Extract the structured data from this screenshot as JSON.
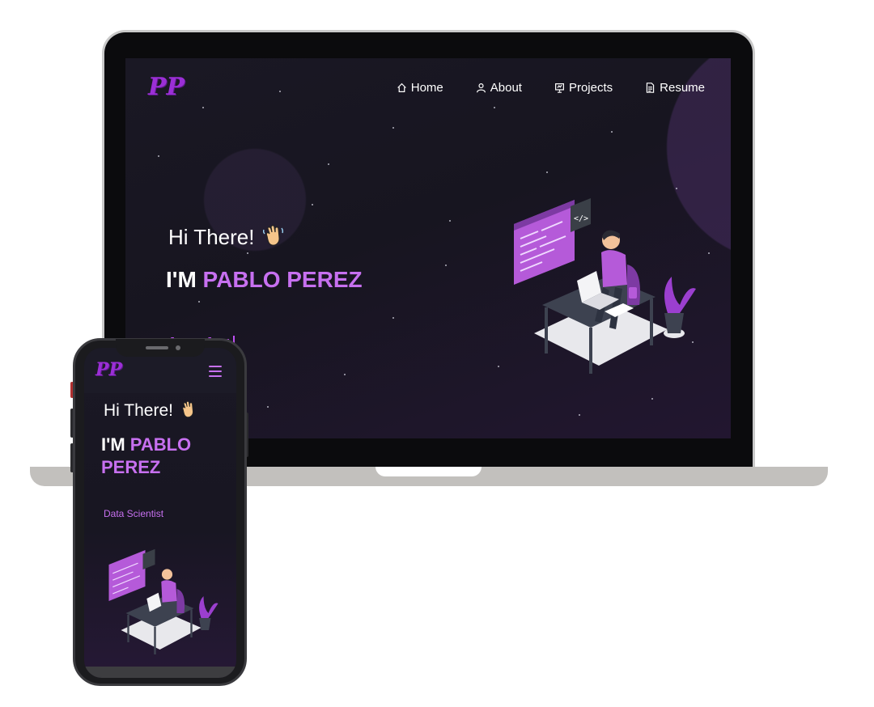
{
  "logo": {
    "text": "PP"
  },
  "nav": {
    "items": [
      {
        "label": "Home",
        "icon": "home-icon"
      },
      {
        "label": "About",
        "icon": "user-icon"
      },
      {
        "label": "Projects",
        "icon": "presentation-icon"
      },
      {
        "label": "Resume",
        "icon": "document-icon"
      }
    ]
  },
  "hero": {
    "greeting": "Hi There!",
    "name_prefix": "I'M",
    "name": "PABLO PEREZ",
    "role_visible": "cientist",
    "wave_icon": "waving-hand-icon"
  },
  "mobile": {
    "greeting": "Hi There!",
    "name_prefix": "I'M",
    "name": "PABLO PEREZ",
    "role": "Data Scientist",
    "menu_icon": "hamburger-menu-icon"
  },
  "colors": {
    "accent": "#c770f0",
    "accent_dark": "#9b2fd6",
    "background": "#1a1824",
    "text": "#ffffff"
  }
}
